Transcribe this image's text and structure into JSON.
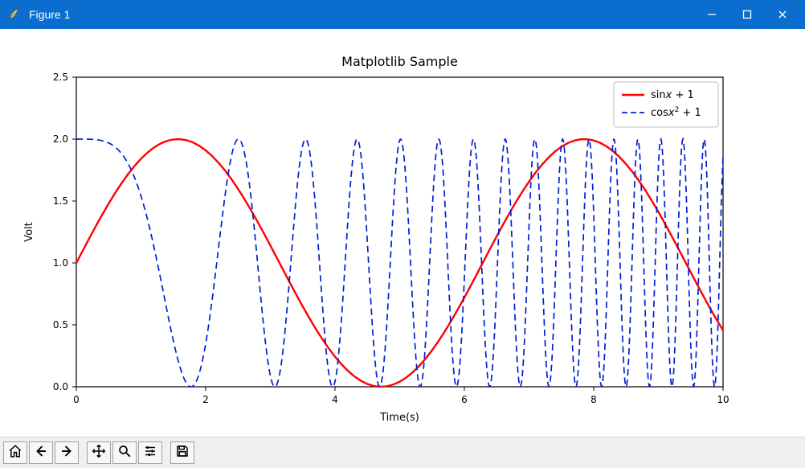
{
  "window": {
    "title": "Figure 1"
  },
  "chart_data": {
    "type": "line",
    "title": "Matplotlib Sample",
    "xlabel": "Time(s)",
    "ylabel": "Volt",
    "xlim": [
      0,
      10
    ],
    "ylim": [
      0,
      2.5
    ],
    "xticks": [
      0,
      2,
      4,
      6,
      8,
      10
    ],
    "yticks": [
      0.0,
      0.5,
      1.0,
      1.5,
      2.0,
      2.5
    ],
    "legend_position": "upper right",
    "series": [
      {
        "name": "sinx + 1",
        "legend_html": "sin<i>x</i> + 1",
        "color": "#ff0000",
        "linestyle": "solid",
        "linewidth": 2.4,
        "formula": "sin(x) + 1",
        "x_range": [
          0,
          10
        ],
        "sample_points_step": 0.1
      },
      {
        "name": "cosx^2 + 1",
        "legend_html": "cos<i>x</i><sup>2</sup> + 1",
        "color": "#0020d0",
        "linestyle": "dashed",
        "linewidth": 1.7,
        "formula": "cos(x*x) + 1",
        "x_range": [
          0,
          10
        ],
        "sample_points_step": 0.01
      }
    ]
  },
  "toolbar": {
    "buttons": [
      {
        "id": "home",
        "icon": "home-icon",
        "title": "Reset original view"
      },
      {
        "id": "back",
        "icon": "arrow-left-icon",
        "title": "Back to previous view"
      },
      {
        "id": "fwd",
        "icon": "arrow-right-icon",
        "title": "Forward to next view"
      },
      {
        "sep": true
      },
      {
        "id": "pan",
        "icon": "move-icon",
        "title": "Pan axes"
      },
      {
        "id": "zoom",
        "icon": "zoom-icon",
        "title": "Zoom to rectangle"
      },
      {
        "id": "config",
        "icon": "sliders-icon",
        "title": "Configure subplots"
      },
      {
        "sep": true
      },
      {
        "id": "save",
        "icon": "save-icon",
        "title": "Save the figure"
      }
    ]
  }
}
